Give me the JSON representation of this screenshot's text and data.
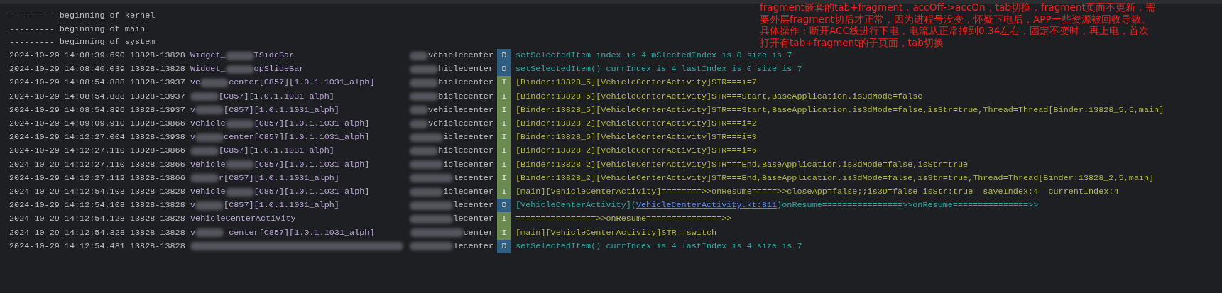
{
  "header_lines": [
    "--------- beginning of kernel",
    "--------- beginning of main",
    "--------- beginning of system"
  ],
  "rows": [
    {
      "time": "2024-10-29 14:08:39.690",
      "pid": "13828-13828",
      "tag": "Widget_",
      "tag_rest": "TSideBar",
      "package": "vehiclecenter",
      "level": "D",
      "message": [
        {
          "text": "setSelectedItem index is 4 mSlectedIndex is 0 size is 7"
        }
      ]
    },
    {
      "time": "2024-10-29 14:08:40.039",
      "pid": "13828-13828",
      "tag": "Widget_",
      "tag_rest": "opSlideBar",
      "package": "hiclecenter",
      "level": "D",
      "message": [
        {
          "text": "setSelectedItem() currIndex is 4 lastIndex is 0 size is 7"
        }
      ]
    },
    {
      "time": "2024-10-29 14:08:54.888",
      "pid": "13828-13937",
      "tag": "ve",
      "tag_rest": "center[C857][1.0.1.1031_alph]",
      "package": "hiclecenter",
      "level": "I",
      "message": [
        {
          "text": "[Binder:13828_5][VehicleCenterActivity]STR===i=7"
        }
      ]
    },
    {
      "time": "2024-10-29 14:08:54.888",
      "pid": "13828-13937",
      "tag": "",
      "tag_rest": "[C857][1.0.1.1031_alph]",
      "package": "biclecenter",
      "level": "I",
      "message": [
        {
          "text": "[Binder:13828_5][VehicleCenterActivity]STR===Start,BaseApplication.is3dMode=false"
        }
      ]
    },
    {
      "time": "2024-10-29 14:08:54.896",
      "pid": "13828-13937",
      "tag": "v",
      "tag_rest": "[C857][1.0.1.1031_alph]",
      "package": "vehiclecenter",
      "level": "I",
      "message": [
        {
          "text": "[Binder:13828_5][VehicleCenterActivity]STR===Start,BaseApplication.is3dMode=false,isStr=true,Thread=Thread[Binder:13828_5,5,main]"
        }
      ]
    },
    {
      "time": "2024-10-29 14:09:09.910",
      "pid": "13828-13866",
      "tag": "vehicle",
      "tag_rest": "[C857][1.0.1.1031_alph]",
      "package": "vehiclecenter",
      "level": "I",
      "message": [
        {
          "text": "[Binder:13828_2][VehicleCenterActivity]STR===i=2"
        }
      ]
    },
    {
      "time": "2024-10-29 14:12:27.004",
      "pid": "13828-13938",
      "tag": "v",
      "tag_rest": "center[C857][1.0.1.1031_alph]",
      "package": "iclecenter",
      "level": "I",
      "message": [
        {
          "text": "[Binder:13828_6][VehicleCenterActivity]STR===i=3"
        }
      ]
    },
    {
      "time": "2024-10-29 14:12:27.110",
      "pid": "13828-13866",
      "tag": "",
      "tag_rest": "[C857][1.0.1.1031_alph]",
      "package": "hiclecenter",
      "level": "I",
      "message": [
        {
          "text": "[Binder:13828_2][VehicleCenterActivity]STR===i=6"
        }
      ]
    },
    {
      "time": "2024-10-29 14:12:27.110",
      "pid": "13828-13866",
      "tag": "vehicle",
      "tag_rest": "[C857][1.0.1.1031_alph]",
      "package": "iclecenter",
      "level": "I",
      "message": [
        {
          "text": "[Binder:13828_2][VehicleCenterActivity]STR===End,BaseApplication.is3dMode=false,isStr=true"
        }
      ]
    },
    {
      "time": "2024-10-29 14:12:27.112",
      "pid": "13828-13866",
      "tag": "",
      "tag_rest": "r[C857][1.0.1.1031_alph]",
      "package": "lecenter",
      "level": "I",
      "message": [
        {
          "text": "[Binder:13828_2][VehicleCenterActivity]STR===End,BaseApplication.is3dMode=false,isStr=true,Thread=Thread[Binder:13828_2,5,main]"
        }
      ]
    },
    {
      "time": "2024-10-29 14:12:54.108",
      "pid": "13828-13828",
      "tag": "vehicle",
      "tag_rest": "[C857][1.0.1.1031_alph]",
      "package": "iclecenter",
      "level": "I",
      "message": [
        {
          "text": "[main][VehicleCenterActivity]========>>onResume=====>>closeApp=false;;is3D=false isStr:true  saveIndex:4  currentIndex:4"
        }
      ]
    },
    {
      "time": "2024-10-29 14:12:54.108",
      "pid": "13828-13828",
      "tag": "v",
      "tag_rest": "[C857][1.0.1.1031_alph]",
      "package": "lecenter",
      "level": "D",
      "message": [
        {
          "text": "[VehicleCenterActivity]("
        },
        {
          "text": "VehicleCenterActivity.kt:811",
          "kind": "link"
        },
        {
          "text": ")onResume================>>onResume===============>>"
        }
      ]
    },
    {
      "time": "2024-10-29 14:12:54.128",
      "pid": "13828-13828",
      "tag": "VehicleCenterActivity",
      "tag_rest": "",
      "package": "lecenter",
      "level": "I",
      "message": [
        {
          "text": "================>>onResume===============>>"
        }
      ]
    },
    {
      "time": "2024-10-29 14:12:54.328",
      "pid": "13828-13828",
      "tag": "v",
      "tag_rest": "-center[C857][1.0.1.1031_alph]",
      "package": "center",
      "level": "I",
      "message": [
        {
          "text": "[main][VehicleCenterActivity]STR==switch"
        }
      ]
    },
    {
      "time": "2024-10-29 14:12:54.481",
      "pid": "13828-13828",
      "tag": "",
      "tag_rest": "",
      "package": "lecenter",
      "level": "D",
      "message": [
        {
          "text": "setSelectedItem() currIndex is 4 lastIndex is 4 size is 7"
        }
      ]
    }
  ],
  "annotation": [
    "fragment嵌套的tab+fragment，accOff->accOn，tab切换，fragment页面不更新，需",
    "要外层fragment切后才正常，因为进程号没变，怀疑下电后，APP一些资源被回收导致。",
    "具体操作：断开ACC线进行下电，电流从正常掉到0.34左右，固定不变时，再上电，首次",
    "打开有tab+fragment的子页面，tab切换"
  ]
}
